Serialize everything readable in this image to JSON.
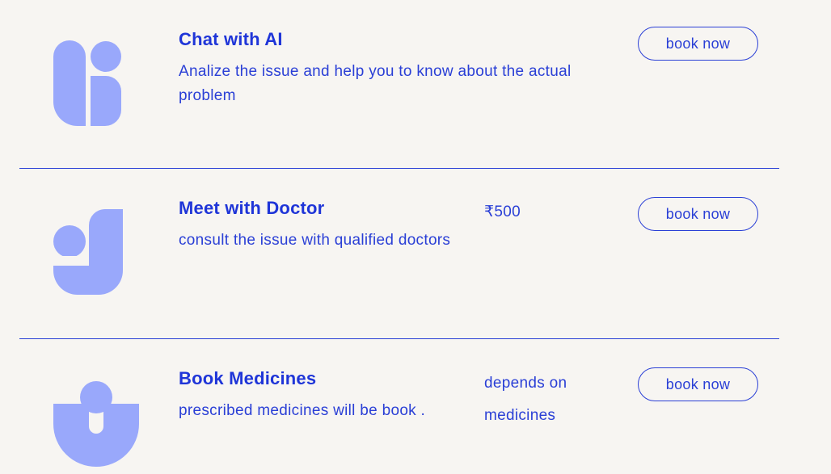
{
  "colors": {
    "background": "#f7f5f2",
    "accent": "#2a3fd6",
    "icon": "#99a8fb"
  },
  "services": [
    {
      "icon": "dot-and-columns-logo-icon",
      "title": "Chat with AI",
      "description": "Analize the issue and help you to know about the actual problem",
      "price": "",
      "button_label": "book now"
    },
    {
      "icon": "j-shape-logo-icon",
      "title": "Meet with Doctor",
      "description": "consult the issue with qualified doctors",
      "price": "₹500",
      "button_label": "book now"
    },
    {
      "icon": "person-cup-logo-icon",
      "title": "Book Medicines",
      "description": "prescribed medicines will be book .",
      "price": "depends on medicines",
      "button_label": "book now"
    }
  ]
}
